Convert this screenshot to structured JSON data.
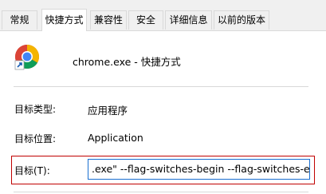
{
  "tabs": [
    {
      "label": "常规"
    },
    {
      "label": "快捷方式"
    },
    {
      "label": "兼容性"
    },
    {
      "label": "安全"
    },
    {
      "label": "详细信息"
    },
    {
      "label": "以前的版本"
    }
  ],
  "header": {
    "icon": "chrome-icon",
    "title": "chrome.exe - 快捷方式"
  },
  "fields": {
    "target_type": {
      "label": "目标类型:",
      "value": "应用程序"
    },
    "target_location": {
      "label": "目标位置:",
      "value": "Application"
    },
    "target": {
      "label": "目标(T):",
      "value": ".exe\" --flag-switches-begin --flag-switches-end"
    }
  },
  "colors": {
    "highlight_border": "#c00000",
    "input_focus_border": "#1a6fd1"
  }
}
